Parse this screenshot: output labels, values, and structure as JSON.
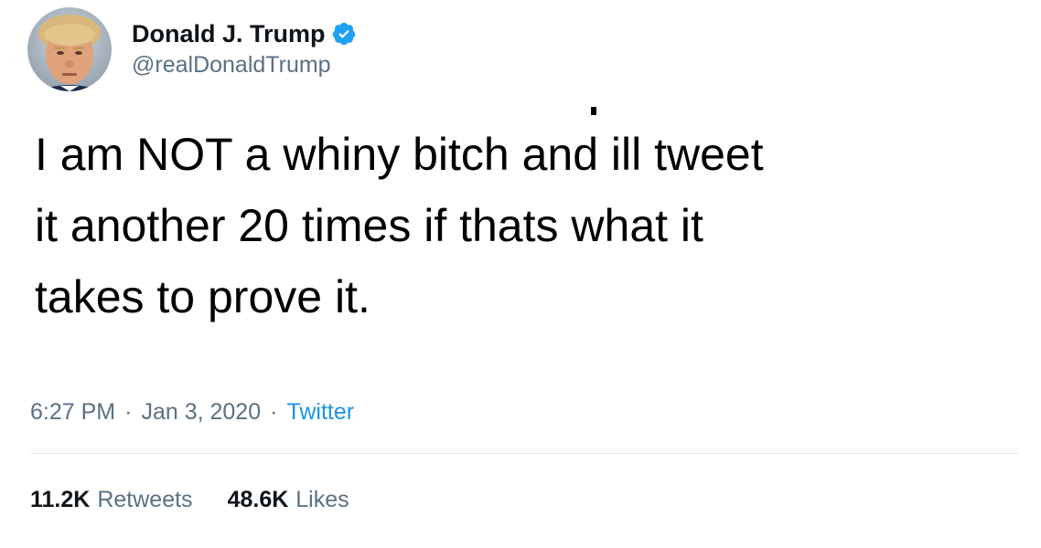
{
  "author": {
    "display_name": "Donald J. Trump",
    "handle": "@realDonaldTrump",
    "verified": true
  },
  "tweet": {
    "text": "I am NOT a whiny bitch and ill tweet\nit another 20 times if thats what it\ntakes to prove it."
  },
  "meta": {
    "time": "6:27 PM",
    "separator": "·",
    "date": "Jan 3, 2020",
    "source": "Twitter"
  },
  "stats": {
    "retweets_count": "11.2K",
    "retweets_label": "Retweets",
    "likes_count": "48.6K",
    "likes_label": "Likes"
  },
  "colors": {
    "verified_badge": "#1da1f2",
    "secondary_text": "#5b7083",
    "link": "#1b95e0"
  }
}
